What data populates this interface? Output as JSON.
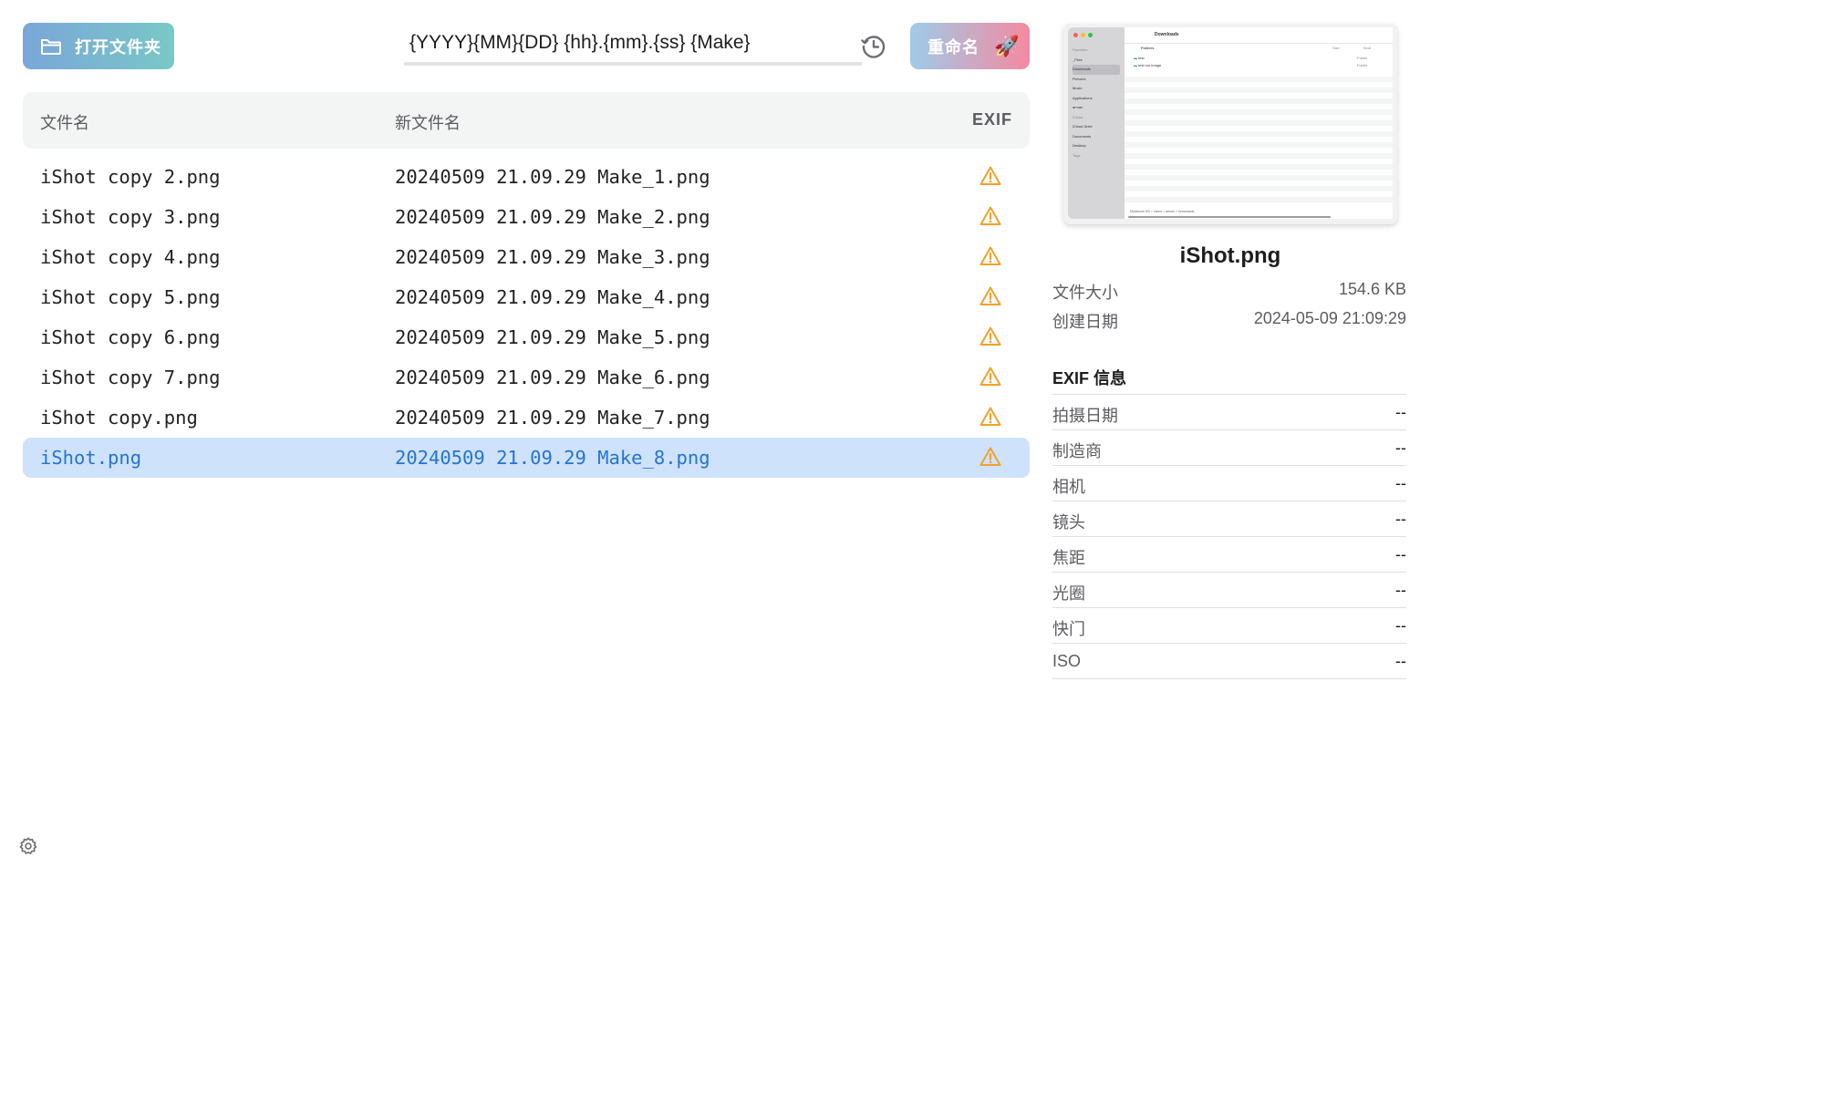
{
  "toolbar": {
    "open_label": "打开文件夹",
    "pattern_value": "{YYYY}{MM}{DD} {hh}.{mm}.{ss} {Make}",
    "rename_label": "重命名",
    "rocket_glyph": "🚀"
  },
  "table": {
    "headers": {
      "filename": "文件名",
      "new_filename": "新文件名",
      "exif": "EXIF"
    },
    "rows": [
      {
        "filename": "iShot copy 2.png",
        "new_filename": "20240509 21.09.29 Make_1.png",
        "exif_status": "warning-icon"
      },
      {
        "filename": "iShot copy 3.png",
        "new_filename": "20240509 21.09.29 Make_2.png",
        "exif_status": "warning-icon"
      },
      {
        "filename": "iShot copy 4.png",
        "new_filename": "20240509 21.09.29 Make_3.png",
        "exif_status": "warning-icon"
      },
      {
        "filename": "iShot copy 5.png",
        "new_filename": "20240509 21.09.29 Make_4.png",
        "exif_status": "warning-icon"
      },
      {
        "filename": "iShot copy 6.png",
        "new_filename": "20240509 21.09.29 Make_5.png",
        "exif_status": "warning-icon"
      },
      {
        "filename": "iShot copy 7.png",
        "new_filename": "20240509 21.09.29 Make_6.png",
        "exif_status": "warning-icon"
      },
      {
        "filename": "iShot copy.png",
        "new_filename": "20240509 21.09.29 Make_7.png",
        "exif_status": "warning-icon"
      },
      {
        "filename": "iShot.png",
        "new_filename": "20240509 21.09.29 Make_8.png",
        "exif_status": "warning-icon",
        "selected": true
      }
    ]
  },
  "detail": {
    "title": "iShot.png",
    "file_size_label": "文件大小",
    "file_size": "154.6 KB",
    "created_label": "创建日期",
    "created": "2024-05-09 21:09:29",
    "exif_heading": "EXIF 信息",
    "exif": [
      {
        "label": "拍摄日期",
        "value": "--"
      },
      {
        "label": "制造商",
        "value": "--"
      },
      {
        "label": "相机",
        "value": "--"
      },
      {
        "label": "镜头",
        "value": "--"
      },
      {
        "label": "焦距",
        "value": "--"
      },
      {
        "label": "光圈",
        "value": "--"
      },
      {
        "label": "快门",
        "value": "--"
      },
      {
        "label": "ISO",
        "value": "--"
      }
    ]
  },
  "preview": {
    "window_title": "Downloads",
    "sidebar_items": [
      "Favorites",
      "_Files",
      "Downloads",
      "Pictures",
      "Music",
      "Applications",
      "arman",
      "iCloud",
      "iCloud Drive",
      "Documents",
      "Desktop",
      "Tags"
    ],
    "folders_header": "Folders",
    "size_header": "Size",
    "kind_header": "Kind",
    "rows": [
      {
        "name": "test",
        "kind": "Folder"
      },
      {
        "name": "test not image",
        "kind": "Folder"
      }
    ],
    "pathbar": "Macintosh HD > Users > arman > Downloads"
  },
  "colors": {
    "accent": "#2474d4",
    "selection": "#cfe2fb",
    "warning": "#f2a12a"
  }
}
